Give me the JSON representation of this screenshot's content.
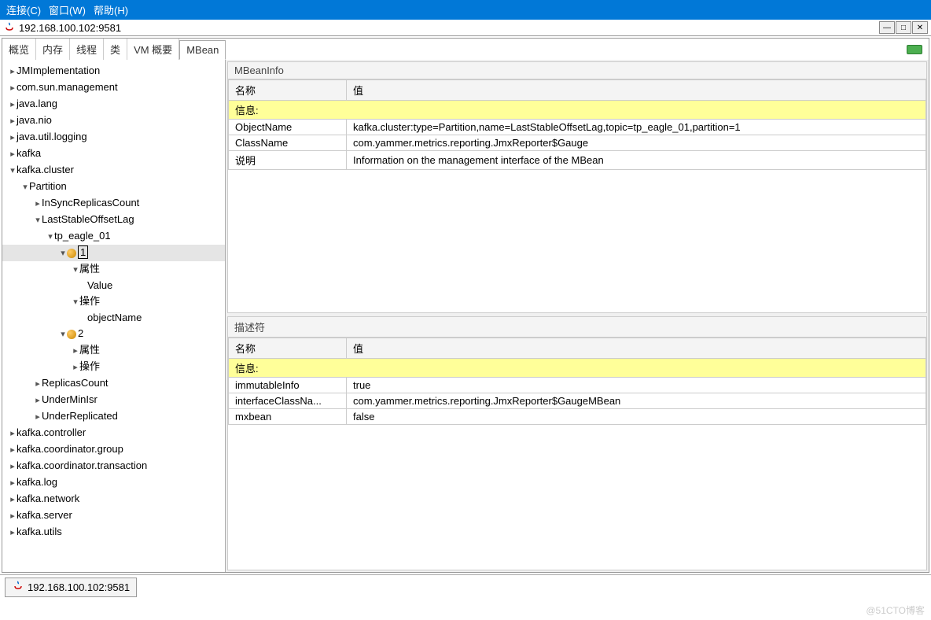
{
  "menubar": {
    "connect": "连接(C)",
    "window": "窗口(W)",
    "help": "帮助(H)"
  },
  "title": "192.168.100.102:9581",
  "tabs": [
    "概览",
    "内存",
    "线程",
    "类",
    "VM 概要",
    "MBean"
  ],
  "activeTab": "MBean",
  "tree": {
    "n0": "JMImplementation",
    "n1": "com.sun.management",
    "n2": "java.lang",
    "n3": "java.nio",
    "n4": "java.util.logging",
    "n5": "kafka",
    "n6": "kafka.cluster",
    "n6_0": "Partition",
    "n6_0_0": "InSyncReplicasCount",
    "n6_0_1": "LastStableOffsetLag",
    "n6_0_1_0": "tp_eagle_01",
    "n6_0_1_0_0": "1",
    "n6_0_1_0_0_0": "属性",
    "n6_0_1_0_0_0_0": "Value",
    "n6_0_1_0_0_1": "操作",
    "n6_0_1_0_0_1_0": "objectName",
    "n6_0_1_0_1": "2",
    "n6_0_1_0_1_0": "属性",
    "n6_0_1_0_1_1": "操作",
    "n6_0_2": "ReplicasCount",
    "n6_0_3": "UnderMinIsr",
    "n6_0_4": "UnderReplicated",
    "n7": "kafka.controller",
    "n8": "kafka.coordinator.group",
    "n9": "kafka.coordinator.transaction",
    "n10": "kafka.log",
    "n11": "kafka.network",
    "n12": "kafka.server",
    "n13": "kafka.utils"
  },
  "mbeaninfo": {
    "title": "MBeanInfo",
    "col_name": "名称",
    "col_value": "值",
    "section": "信息:",
    "rows": [
      {
        "name": "ObjectName",
        "value": "kafka.cluster:type=Partition,name=LastStableOffsetLag,topic=tp_eagle_01,partition=1"
      },
      {
        "name": "ClassName",
        "value": "com.yammer.metrics.reporting.JmxReporter$Gauge"
      },
      {
        "name": "说明",
        "value": "Information on the management interface of the MBean"
      }
    ]
  },
  "descriptor": {
    "title": "描述符",
    "col_name": "名称",
    "col_value": "值",
    "section": "信息:",
    "rows": [
      {
        "name": "immutableInfo",
        "value": "true"
      },
      {
        "name": "interfaceClassNa...",
        "value": "com.yammer.metrics.reporting.JmxReporter$GaugeMBean"
      },
      {
        "name": "mxbean",
        "value": "false"
      }
    ]
  },
  "status": "192.168.100.102:9581",
  "watermark": "@51CTO博客"
}
